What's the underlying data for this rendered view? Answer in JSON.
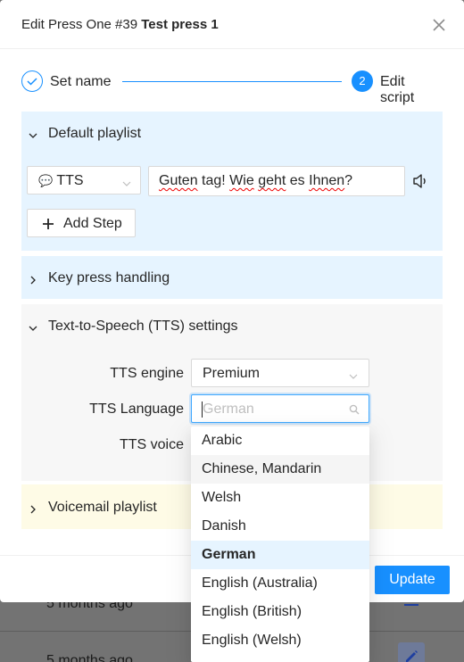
{
  "background": {
    "rows": [
      {
        "text": "5 months ago"
      },
      {
        "text": "5 months ago"
      }
    ]
  },
  "modal": {
    "title_prefix": "Edit Press One #39",
    "title_name": "Test press 1",
    "steps": [
      {
        "label": "Set name",
        "status": "done"
      },
      {
        "number": "2",
        "label": "Edit script",
        "status": "current"
      }
    ],
    "default_playlist": {
      "label": "Default playlist",
      "expanded": true,
      "type_select": {
        "icon": "💬",
        "value": "TTS"
      },
      "text_words": [
        "Guten",
        " tag! ",
        "Wie",
        " ",
        "geht",
        " es ",
        "Ihnen",
        "?"
      ],
      "add_step_label": "Add Step"
    },
    "key_press": {
      "label": "Key press handling",
      "expanded": false
    },
    "tts_settings": {
      "label": "Text-to-Speech (TTS) settings",
      "expanded": true,
      "engine_label": "TTS engine",
      "engine_value": "Premium",
      "language_label": "TTS Language",
      "language_placeholder": "German",
      "voice_label": "TTS voice"
    },
    "voicemail": {
      "label": "Voicemail playlist",
      "expanded": false
    },
    "update_label": "Update"
  },
  "language_options": [
    {
      "label": "Arabic",
      "state": ""
    },
    {
      "label": "Chinese, Mandarin",
      "state": "hover"
    },
    {
      "label": "Welsh",
      "state": ""
    },
    {
      "label": "Danish",
      "state": ""
    },
    {
      "label": "German",
      "state": "selected"
    },
    {
      "label": "English (Australia)",
      "state": ""
    },
    {
      "label": "English (British)",
      "state": ""
    },
    {
      "label": "English (Welsh)",
      "state": ""
    }
  ],
  "colors": {
    "primary": "#1890ff",
    "panel_blue": "#e6f4ff",
    "panel_grey": "#f7f7f7",
    "panel_yellow": "#fefbe6"
  }
}
